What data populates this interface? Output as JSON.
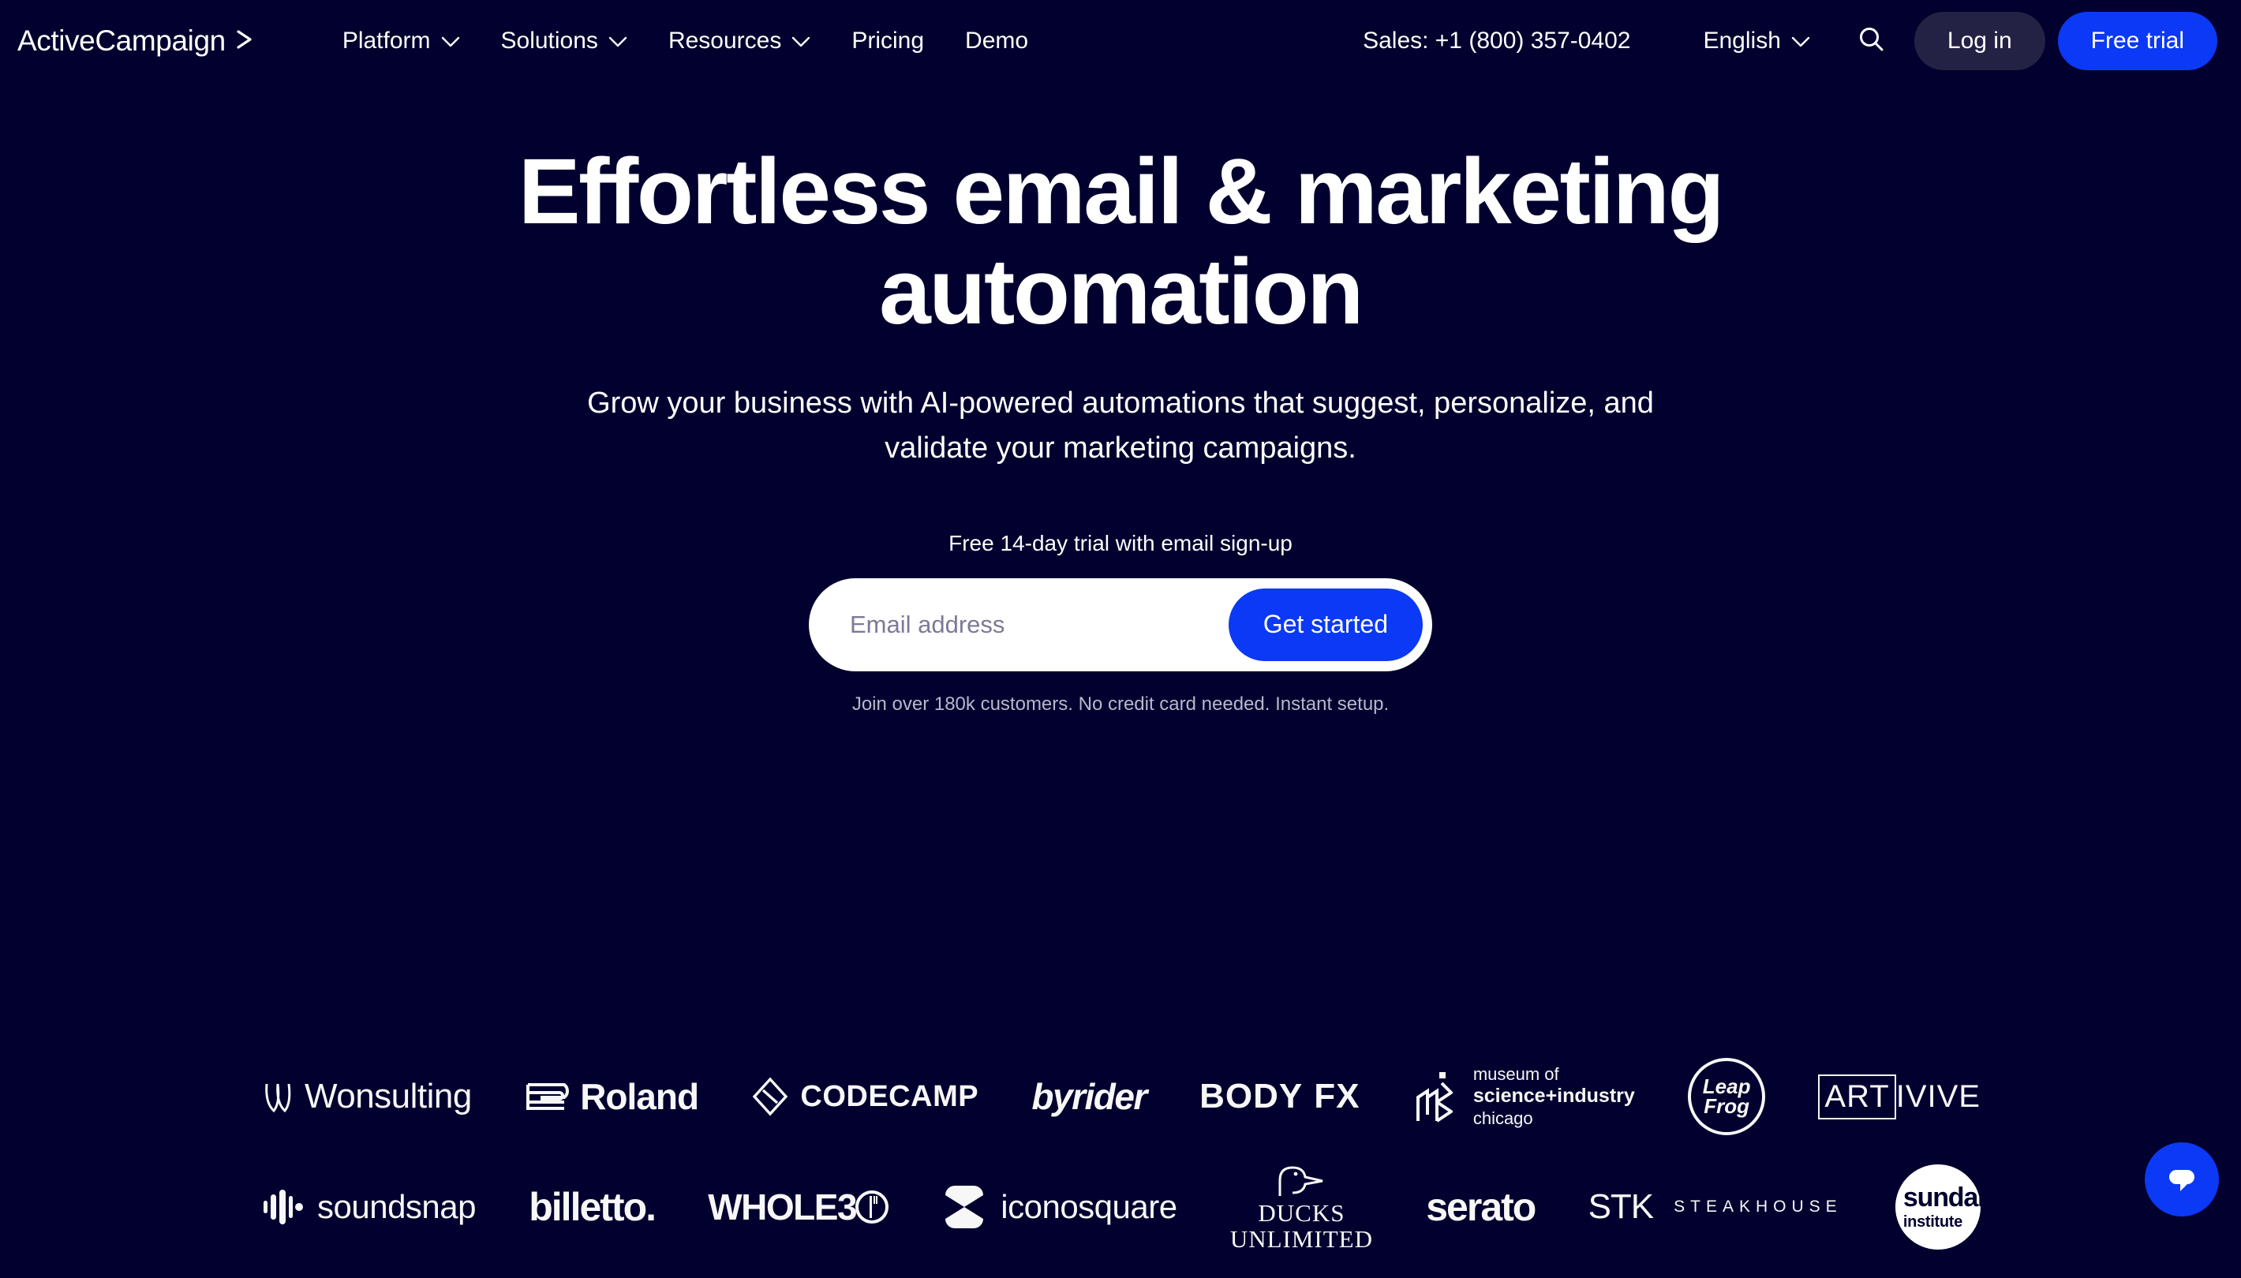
{
  "colors": {
    "background": "#01002e",
    "accent_blue": "#0b39f5",
    "login_pill": "#242244",
    "text_primary": "#ffffff",
    "fineprint": "#b9b7cc"
  },
  "navbar": {
    "logo_text": "ActiveCampaign",
    "logo_icon": "chevron-right-mark",
    "links": [
      {
        "label": "Platform",
        "has_dropdown": true
      },
      {
        "label": "Solutions",
        "has_dropdown": true
      },
      {
        "label": "Resources",
        "has_dropdown": true
      },
      {
        "label": "Pricing",
        "has_dropdown": false
      },
      {
        "label": "Demo",
        "has_dropdown": false
      }
    ],
    "sales_phone": "Sales: +1 (800) 357-0402",
    "language": "English",
    "search_icon": "search-icon",
    "login_label": "Log in",
    "trial_label": "Free trial"
  },
  "hero": {
    "headline": "Effortless email & marketing automation",
    "subheadline": "Grow your business with AI-powered automations that suggest, personalize, and validate your marketing campaigns.",
    "form_label": "Free 14-day trial with email sign-up",
    "email_placeholder": "Email address",
    "email_value": "",
    "cta_label": "Get started",
    "fineprint": "Join over 180k customers. No credit card needed. Instant setup."
  },
  "logo_wall": {
    "row1": [
      {
        "name": "Wonsulting"
      },
      {
        "name": "Roland"
      },
      {
        "name": "CODECAMP"
      },
      {
        "name": "byrider"
      },
      {
        "name": "BODY",
        "name2": "FX"
      },
      {
        "name": "museum of",
        "name2": "science+industry",
        "name3": "chicago"
      },
      {
        "name": "Leap",
        "name2": "Frog"
      },
      {
        "name": "ART",
        "name2": "IVIVE"
      }
    ],
    "row2": [
      {
        "name": "soundsnap"
      },
      {
        "name": "billetto."
      },
      {
        "name": "WHOLE3"
      },
      {
        "name": "iconosquare"
      },
      {
        "name": "DUCKS",
        "name2": "UNLIMITED"
      },
      {
        "name": "serato"
      },
      {
        "name": "STK",
        "name2": "STEAKHOUSE"
      },
      {
        "name": "sundance",
        "name2": "institute"
      }
    ]
  },
  "chat": {
    "icon": "chat-bubble-icon"
  }
}
